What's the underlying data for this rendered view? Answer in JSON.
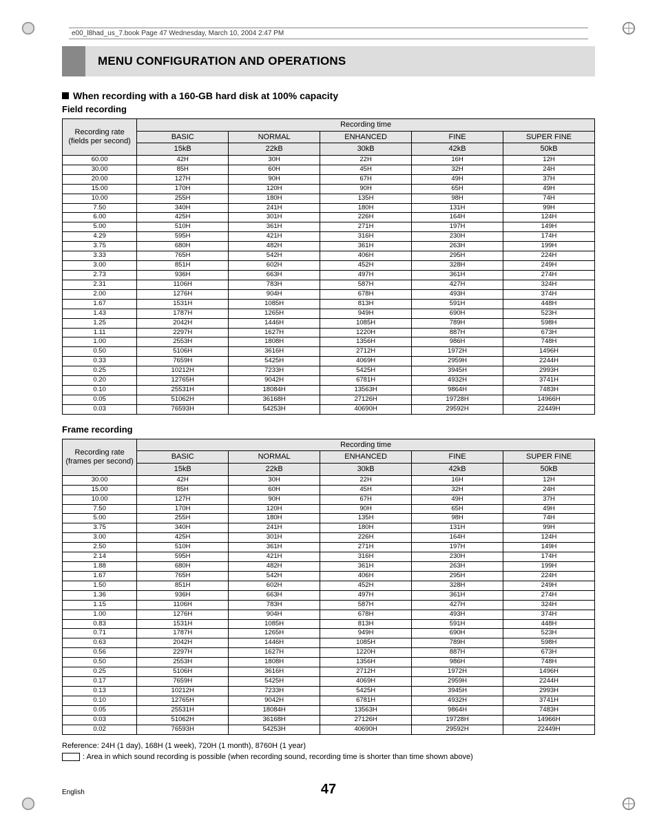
{
  "print_header": "e00_l8had_us_7.book  Page 47  Wednesday, March 10, 2004  2:47 PM",
  "section_title": "MENU CONFIGURATION AND OPERATIONS",
  "subheading": "When recording with a 160-GB hard disk at 100% capacity",
  "field_label": "Field recording",
  "frame_label": "Frame recording",
  "header_rate_field": "Recording rate",
  "header_rate_field_sub": "(fields per second)",
  "header_rate_frame_sub": "(frames per second)",
  "header_rectime": "Recording time",
  "cols": [
    {
      "name": "BASIC",
      "size": "15kB"
    },
    {
      "name": "NORMAL",
      "size": "22kB"
    },
    {
      "name": "ENHANCED",
      "size": "30kB"
    },
    {
      "name": "FINE",
      "size": "42kB"
    },
    {
      "name": "SUPER FINE",
      "size": "50kB"
    }
  ],
  "field_rows": [
    {
      "rate": "60.00",
      "v": [
        "42H",
        "30H",
        "22H",
        "16H",
        "12H"
      ]
    },
    {
      "rate": "30.00",
      "v": [
        "85H",
        "60H",
        "45H",
        "32H",
        "24H"
      ]
    },
    {
      "rate": "20.00",
      "v": [
        "127H",
        "90H",
        "67H",
        "49H",
        "37H"
      ]
    },
    {
      "rate": "15.00",
      "v": [
        "170H",
        "120H",
        "90H",
        "65H",
        "49H"
      ]
    },
    {
      "rate": "10.00",
      "v": [
        "255H",
        "180H",
        "135H",
        "98H",
        "74H"
      ]
    },
    {
      "rate": "7.50",
      "v": [
        "340H",
        "241H",
        "180H",
        "131H",
        "99H"
      ]
    },
    {
      "rate": "6.00",
      "v": [
        "425H",
        "301H",
        "226H",
        "164H",
        "124H"
      ]
    },
    {
      "rate": "5.00",
      "v": [
        "510H",
        "361H",
        "271H",
        "197H",
        "149H"
      ]
    },
    {
      "rate": "4.29",
      "v": [
        "595H",
        "421H",
        "316H",
        "230H",
        "174H"
      ]
    },
    {
      "rate": "3.75",
      "v": [
        "680H",
        "482H",
        "361H",
        "263H",
        "199H"
      ]
    },
    {
      "rate": "3.33",
      "v": [
        "765H",
        "542H",
        "406H",
        "295H",
        "224H"
      ]
    },
    {
      "rate": "3.00",
      "v": [
        "851H",
        "602H",
        "452H",
        "328H",
        "249H"
      ]
    },
    {
      "rate": "2.73",
      "v": [
        "936H",
        "663H",
        "497H",
        "361H",
        "274H"
      ]
    },
    {
      "rate": "2.31",
      "v": [
        "1106H",
        "783H",
        "587H",
        "427H",
        "324H"
      ]
    },
    {
      "rate": "2.00",
      "v": [
        "1276H",
        "904H",
        "678H",
        "493H",
        "374H"
      ]
    },
    {
      "rate": "1.67",
      "v": [
        "1531H",
        "1085H",
        "813H",
        "591H",
        "448H"
      ]
    },
    {
      "rate": "1.43",
      "v": [
        "1787H",
        "1265H",
        "949H",
        "690H",
        "523H"
      ]
    },
    {
      "rate": "1.25",
      "v": [
        "2042H",
        "1446H",
        "1085H",
        "789H",
        "598H"
      ]
    },
    {
      "rate": "1.11",
      "v": [
        "2297H",
        "1627H",
        "1220H",
        "887H",
        "673H"
      ]
    },
    {
      "rate": "1.00",
      "v": [
        "2553H",
        "1808H",
        "1356H",
        "986H",
        "748H"
      ]
    },
    {
      "rate": "0.50",
      "v": [
        "5106H",
        "3616H",
        "2712H",
        "1972H",
        "1496H"
      ]
    },
    {
      "rate": "0.33",
      "v": [
        "7659H",
        "5425H",
        "4069H",
        "2959H",
        "2244H"
      ]
    },
    {
      "rate": "0.25",
      "v": [
        "10212H",
        "7233H",
        "5425H",
        "3945H",
        "2993H"
      ]
    },
    {
      "rate": "0.20",
      "v": [
        "12765H",
        "9042H",
        "6781H",
        "4932H",
        "3741H"
      ]
    },
    {
      "rate": "0.10",
      "v": [
        "25531H",
        "18084H",
        "13563H",
        "9864H",
        "7483H"
      ]
    },
    {
      "rate": "0.05",
      "v": [
        "51062H",
        "36168H",
        "27126H",
        "19728H",
        "14966H"
      ]
    },
    {
      "rate": "0.03",
      "v": [
        "76593H",
        "54253H",
        "40690H",
        "29592H",
        "22449H"
      ]
    }
  ],
  "frame_rows": [
    {
      "rate": "30.00",
      "v": [
        "42H",
        "30H",
        "22H",
        "16H",
        "12H"
      ]
    },
    {
      "rate": "15.00",
      "v": [
        "85H",
        "60H",
        "45H",
        "32H",
        "24H"
      ]
    },
    {
      "rate": "10.00",
      "v": [
        "127H",
        "90H",
        "67H",
        "49H",
        "37H"
      ]
    },
    {
      "rate": "7.50",
      "v": [
        "170H",
        "120H",
        "90H",
        "65H",
        "49H"
      ]
    },
    {
      "rate": "5.00",
      "v": [
        "255H",
        "180H",
        "135H",
        "98H",
        "74H"
      ]
    },
    {
      "rate": "3.75",
      "v": [
        "340H",
        "241H",
        "180H",
        "131H",
        "99H"
      ]
    },
    {
      "rate": "3.00",
      "v": [
        "425H",
        "301H",
        "226H",
        "164H",
        "124H"
      ]
    },
    {
      "rate": "2.50",
      "v": [
        "510H",
        "361H",
        "271H",
        "197H",
        "149H"
      ]
    },
    {
      "rate": "2.14",
      "v": [
        "595H",
        "421H",
        "316H",
        "230H",
        "174H"
      ]
    },
    {
      "rate": "1.88",
      "v": [
        "680H",
        "482H",
        "361H",
        "263H",
        "199H"
      ]
    },
    {
      "rate": "1.67",
      "v": [
        "765H",
        "542H",
        "406H",
        "295H",
        "224H"
      ]
    },
    {
      "rate": "1.50",
      "v": [
        "851H",
        "602H",
        "452H",
        "328H",
        "249H"
      ]
    },
    {
      "rate": "1.36",
      "v": [
        "936H",
        "663H",
        "497H",
        "361H",
        "274H"
      ]
    },
    {
      "rate": "1.15",
      "v": [
        "1106H",
        "783H",
        "587H",
        "427H",
        "324H"
      ]
    },
    {
      "rate": "1.00",
      "v": [
        "1276H",
        "904H",
        "678H",
        "493H",
        "374H"
      ]
    },
    {
      "rate": "0.83",
      "v": [
        "1531H",
        "1085H",
        "813H",
        "591H",
        "448H"
      ]
    },
    {
      "rate": "0.71",
      "v": [
        "1787H",
        "1265H",
        "949H",
        "690H",
        "523H"
      ]
    },
    {
      "rate": "0.63",
      "v": [
        "2042H",
        "1446H",
        "1085H",
        "789H",
        "598H"
      ]
    },
    {
      "rate": "0.56",
      "v": [
        "2297H",
        "1627H",
        "1220H",
        "887H",
        "673H"
      ]
    },
    {
      "rate": "0.50",
      "v": [
        "2553H",
        "1808H",
        "1356H",
        "986H",
        "748H"
      ]
    },
    {
      "rate": "0.25",
      "v": [
        "5106H",
        "3616H",
        "2712H",
        "1972H",
        "1496H"
      ]
    },
    {
      "rate": "0.17",
      "v": [
        "7659H",
        "5425H",
        "4069H",
        "2959H",
        "2244H"
      ]
    },
    {
      "rate": "0.13",
      "v": [
        "10212H",
        "7233H",
        "5425H",
        "3945H",
        "2993H"
      ]
    },
    {
      "rate": "0.10",
      "v": [
        "12765H",
        "9042H",
        "6781H",
        "4932H",
        "3741H"
      ]
    },
    {
      "rate": "0.05",
      "v": [
        "25531H",
        "18084H",
        "13563H",
        "9864H",
        "7483H"
      ]
    },
    {
      "rate": "0.03",
      "v": [
        "51062H",
        "36168H",
        "27126H",
        "19728H",
        "14966H"
      ]
    },
    {
      "rate": "0.02",
      "v": [
        "76593H",
        "54253H",
        "40690H",
        "29592H",
        "22449H"
      ]
    }
  ],
  "reference_note": "Reference: 24H (1 day), 168H (1 week), 720H (1 month), 8760H (1 year)",
  "sound_note": ": Area in which sound recording is possible (when recording sound, recording time is shorter than time shown above)",
  "footer_lang": "English",
  "footer_page": "47"
}
